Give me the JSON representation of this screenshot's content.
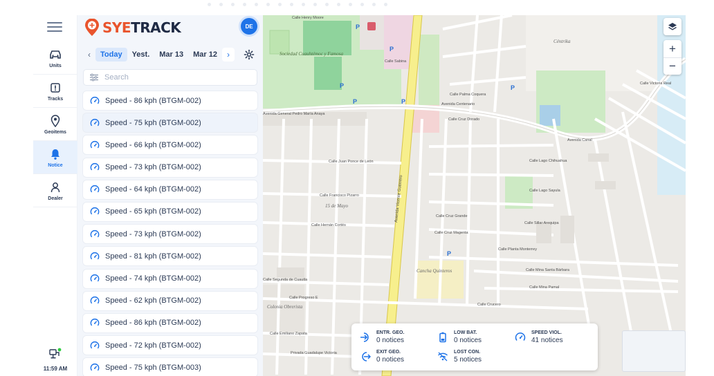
{
  "brand": {
    "logo_text_accent": "SYE",
    "logo_text_rest": "TRACK",
    "accent_color": "#e9542d",
    "primary_color": "#1e73e8"
  },
  "user": {
    "initials": "DE"
  },
  "rail": {
    "items": [
      {
        "label": "Units",
        "icon": "car-icon"
      },
      {
        "label": "Tracks",
        "icon": "route-icon"
      },
      {
        "label": "Geoitems",
        "icon": "pin-icon"
      },
      {
        "label": "Notice",
        "icon": "bell-icon",
        "active": true
      },
      {
        "label": "Dealer",
        "icon": "person-icon"
      }
    ],
    "status_time": "11:59 AM"
  },
  "dates": {
    "items": [
      "Today",
      "Yest.",
      "Mar 13",
      "Mar 12"
    ],
    "active": "Today"
  },
  "search": {
    "placeholder": "Search"
  },
  "notices": [
    "Speed - 86 kph (BTGM-002)",
    "Speed - 75 kph (BTGM-002)",
    "Speed - 66 kph (BTGM-002)",
    "Speed - 73 kph (BTGM-002)",
    "Speed - 64 kph (BTGM-002)",
    "Speed - 65 kph (BTGM-002)",
    "Speed - 73 kph (BTGM-002)",
    "Speed - 81 kph (BTGM-002)",
    "Speed - 74 kph (BTGM-002)",
    "Speed - 62 kph (BTGM-002)",
    "Speed - 86 kph (BTGM-002)",
    "Speed - 72 kph (BTGM-002)",
    "Speed - 75 kph (BTGM-003)"
  ],
  "summary": {
    "entr_geo": {
      "label": "ENTR. GEO.",
      "value": "0 notices"
    },
    "exit_geo": {
      "label": "EXIT GEO.",
      "value": "0 notices"
    },
    "low_bat": {
      "label": "LOW BAT.",
      "value": "0 notices"
    },
    "lost_con": {
      "label": "LOST CON.",
      "value": "5 notices"
    },
    "speed_viol": {
      "label": "SPEED VIOL.",
      "value": "41 notices"
    }
  },
  "map": {
    "streets": {
      "s1": "Calle Henry Moore",
      "s2": "Calle Sabina",
      "s3": "Avenida Vicente Guerrero",
      "s4": "Avenida General Pedro María Anaya",
      "s5": "Avenida Centenario",
      "s6": "Calle Palma Coquera",
      "s7": "Calle Cruz Dorado",
      "s8": "Calle Juan Ponce de León",
      "s9": "Calle Francisco Pizarro",
      "s10": "Calle Hernán Cortés",
      "s11": "Calle Progreso E",
      "s12": "Calle Planta Monterrey",
      "s13": "Calle Mina Santa Bárbara",
      "s14": "Calle Mina Pamal",
      "s15": "Avenida Canal",
      "s16": "Calle Lago Chihuahua",
      "s17": "Calle Lago Sayula",
      "s18": "Calle Victoria Real",
      "s19": "Calle Crucero",
      "s20": "Calle Segunda de Cuautla",
      "s21": "Privada Guadalupe Victoria",
      "s22": "Calle Emiliano Zapata",
      "s23": "Calle Sillar Arequipa",
      "s24": "Calle Cruz Grande",
      "s25": "Calle Cruz Magenta"
    },
    "places": {
      "p1": "Sociedad Cuauhtémoc y Famosa",
      "p2": "Céntrika",
      "p3": "15 de Mayo",
      "p4": "Colonia Obrerista",
      "p5": "Cancha Quinteros"
    }
  }
}
